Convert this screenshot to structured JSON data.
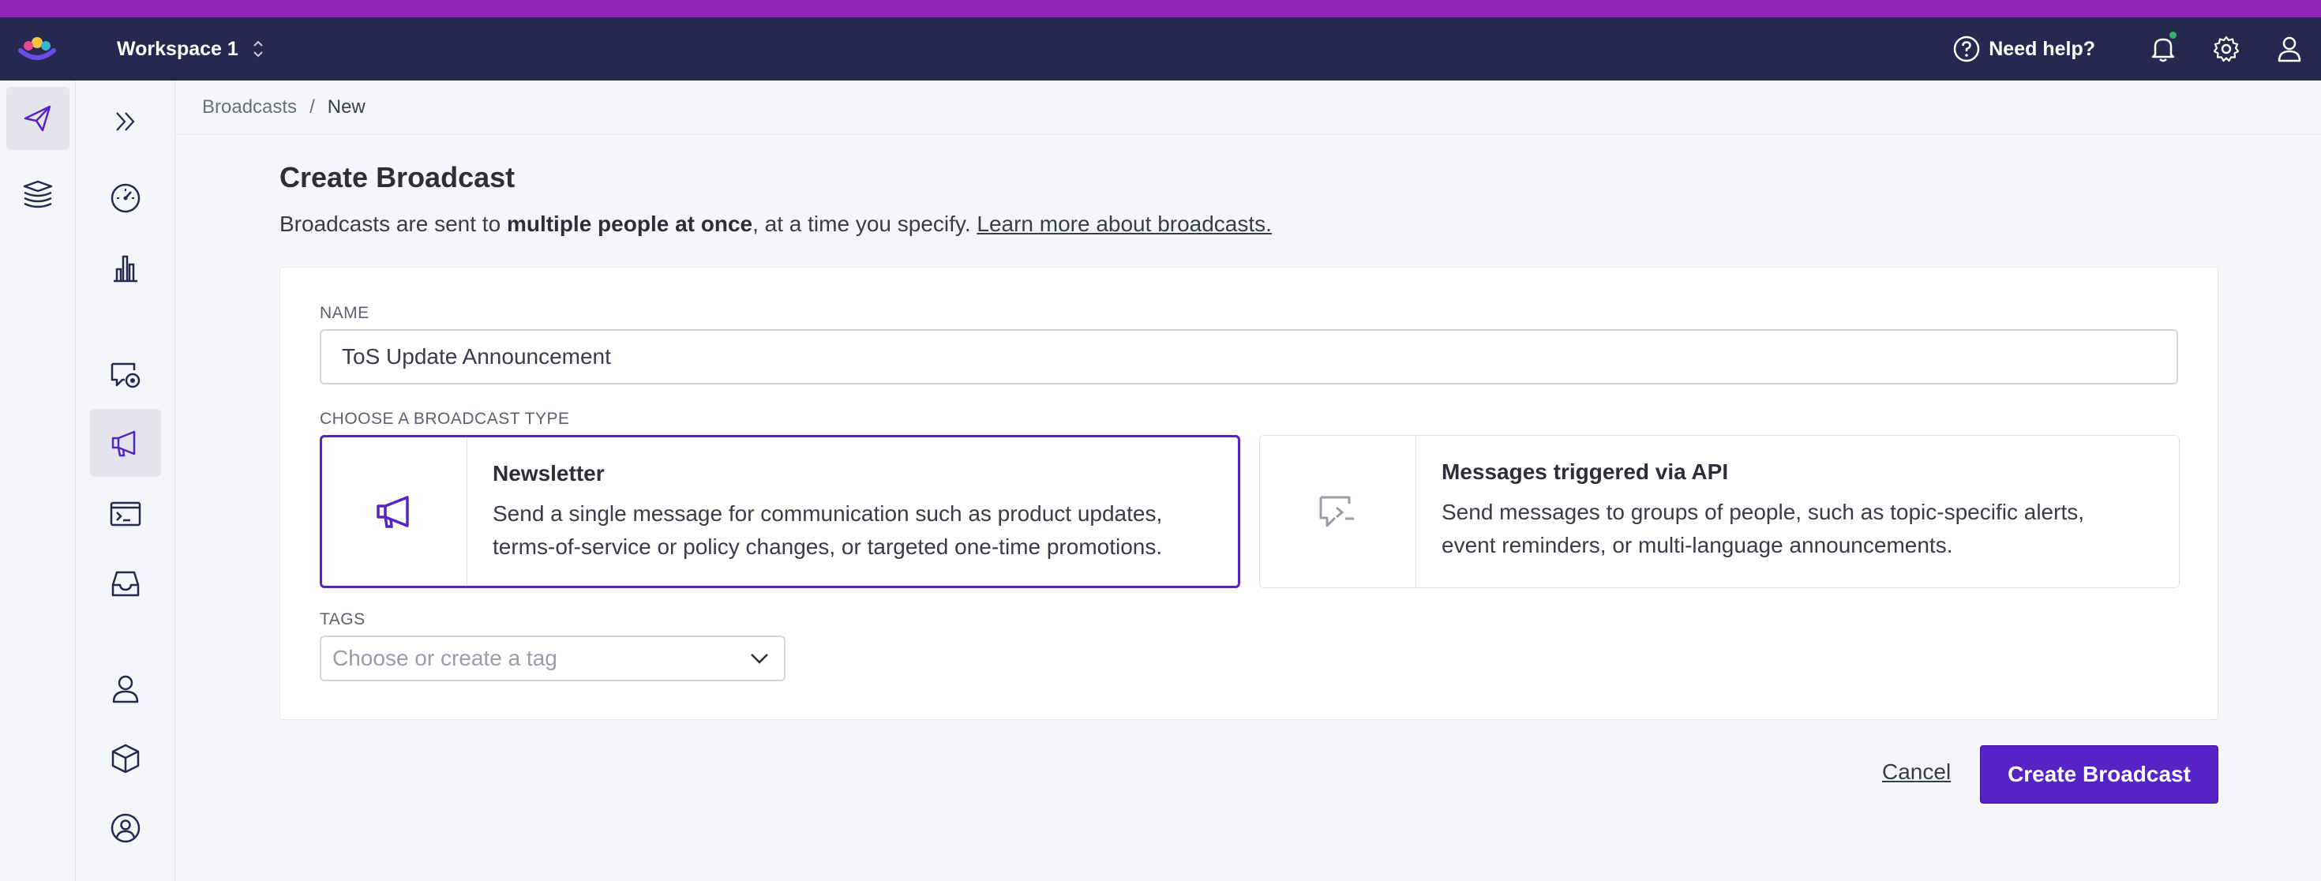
{
  "header": {
    "workspace_label": "Workspace 1",
    "help_label": "Need help?",
    "icons": [
      "logo-icon",
      "bell-icon",
      "gear-icon",
      "user-icon"
    ]
  },
  "rail_primary": [
    "send-icon",
    "layers-icon"
  ],
  "rail_secondary": [
    "expand-icon",
    "dashboard-icon",
    "analytics-icon",
    "chat-settings-icon",
    "megaphone-icon",
    "terminal-icon",
    "inbox-icon",
    "person-icon",
    "cube-icon",
    "account-icon"
  ],
  "breadcrumb": {
    "parent": "Broadcasts",
    "separator": "/",
    "current": "New"
  },
  "page": {
    "title": "Create Broadcast",
    "desc_prefix": "Broadcasts are sent to ",
    "desc_bold": "multiple people at once",
    "desc_suffix": ", at a time you specify. ",
    "desc_link": "Learn more about broadcasts."
  },
  "form": {
    "name_label": "NAME",
    "name_value": "ToS Update Announcement",
    "type_label": "CHOOSE A BROADCAST TYPE",
    "types": [
      {
        "title": "Newsletter",
        "desc_line1": "Send a single message for communication such as product updates,",
        "desc_line2": "terms-of-service or policy changes, or targeted one-time promotions.",
        "selected": true
      },
      {
        "title": "Messages triggered via API",
        "desc_line1": "Send messages to groups of people, such as topic-specific alerts,",
        "desc_line2": "event reminders, or multi-language announcements.",
        "selected": false
      }
    ],
    "tags_label": "TAGS",
    "tags_placeholder": "Choose or create a tag"
  },
  "actions": {
    "cancel_label": "Cancel",
    "create_label": "Create Broadcast"
  },
  "colors": {
    "accent": "#5523c8",
    "topbar": "#26284f",
    "strip": "#8e24b8"
  }
}
